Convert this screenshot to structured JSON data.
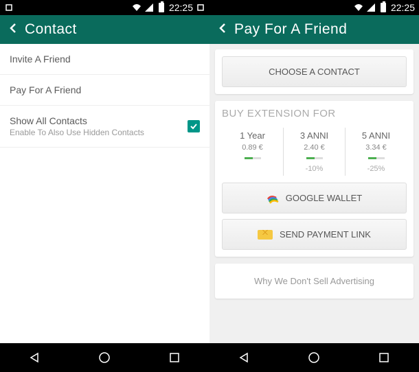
{
  "status": {
    "time": "22:25"
  },
  "left": {
    "header": {
      "title": "Contact"
    },
    "items": [
      {
        "label": "Invite A Friend"
      },
      {
        "label": "Pay For A Friend"
      },
      {
        "label": "Show All Contacts",
        "sublabel": "Enable To Also Use Hidden Contacts",
        "checked": true
      }
    ]
  },
  "right": {
    "header": {
      "title": "Pay For A Friend"
    },
    "choose_contact": "CHOOSE A CONTACT",
    "buy_section_title": "BUY EXTENSION FOR",
    "options": [
      {
        "title": "1 Year",
        "price": "0.89 €",
        "discount": ""
      },
      {
        "title": "3 ANNI",
        "price": "2.40 €",
        "discount": "-10%"
      },
      {
        "title": "5 ANNI",
        "price": "3.34 €",
        "discount": "-25%"
      }
    ],
    "wallet_btn": "GOOGLE WALLET",
    "payment_link_btn": "SEND PAYMENT LINK",
    "ad_link": "Why We Don't Sell Advertising"
  }
}
